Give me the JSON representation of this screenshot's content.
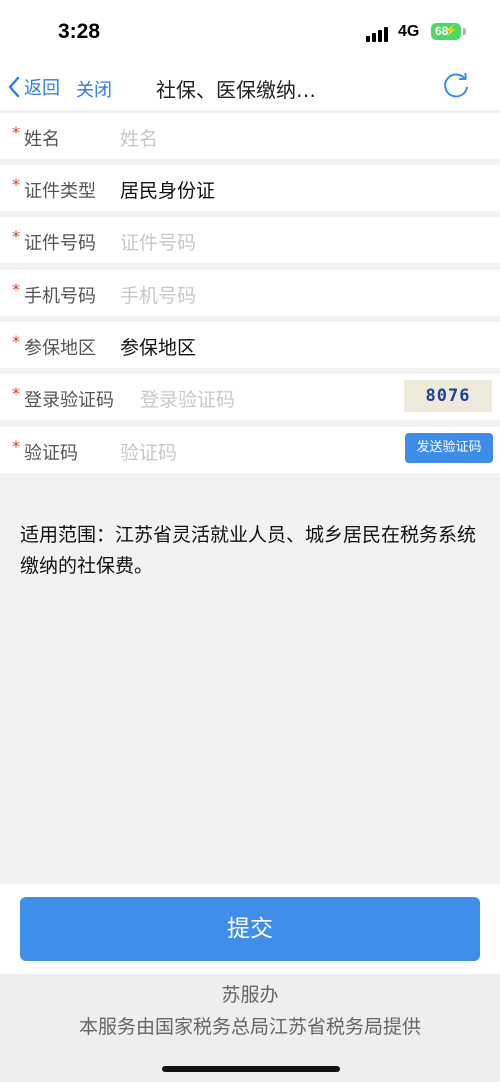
{
  "status_bar": {
    "time": "3:28",
    "network": "4G",
    "battery": "68"
  },
  "nav": {
    "back_label": "返回",
    "close_label": "关闭",
    "title": "社保、医保缴纳…"
  },
  "form": {
    "required_mark": "*",
    "name": {
      "label": "姓名",
      "placeholder": "姓名"
    },
    "id_type": {
      "label": "证件类型",
      "value": "居民身份证"
    },
    "id_number": {
      "label": "证件号码",
      "placeholder": "证件号码"
    },
    "phone": {
      "label": "手机号码",
      "placeholder": "手机号码"
    },
    "region": {
      "label": "参保地区",
      "value": "参保地区"
    },
    "login_captcha": {
      "label": "登录验证码",
      "placeholder": "登录验证码",
      "captcha_image_text": "8076"
    },
    "sms_code": {
      "label": "验证码",
      "placeholder": "验证码",
      "send_button": "发送验证码"
    }
  },
  "scope": "适用范围：江苏省灵活就业人员、城乡居民在税务系统缴纳的社保费。",
  "submit_label": "提交",
  "footer": {
    "brand": "苏服办",
    "provider": "本服务由国家税务总局江苏省税务局提供"
  },
  "colors": {
    "accent": "#3f8ee9",
    "link": "#2f7de1",
    "required": "#e03b2a",
    "background": "#f2f2f4"
  }
}
